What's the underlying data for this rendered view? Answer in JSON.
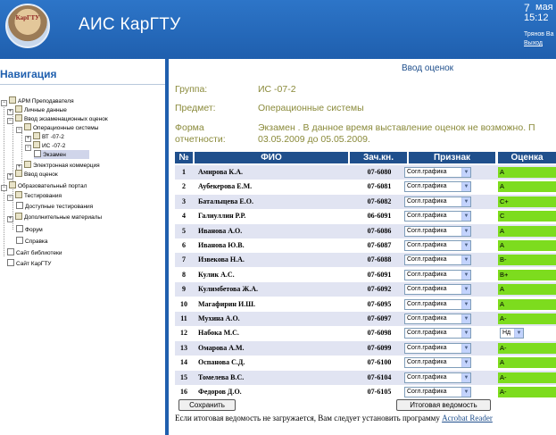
{
  "header": {
    "logo_text": "КарГТУ",
    "app_title": "АИС КарГТУ",
    "date_day": "7",
    "date_month": "мая",
    "time": "15:12",
    "user": "Трянов Ва",
    "logout": "Выход"
  },
  "sidebar": {
    "title": "Навигация",
    "items": [
      "АРМ Преподавателя",
      "Личные данные",
      "Ввод экзаменационных оценок",
      "Операционные системы",
      "ВТ -07-2",
      "ИС -07-2",
      "Экзамен",
      "Электронная коммерция",
      "Ввод оценок",
      "Образовательный портал",
      "Тестирования",
      "Доступные тестирования",
      "Дополнительные материалы",
      "Форум",
      "Справка",
      "Сайт библиотеки",
      "Сайт КарГТУ"
    ]
  },
  "main": {
    "page_title": "Ввод оценок",
    "group_label": "Группа:",
    "group_value": "ИС -07-2",
    "subject_label": "Предмет:",
    "subject_value": "Операционные системы",
    "form_label_1": "Форма",
    "form_label_2": "отчетности:",
    "form_value_1": "Экзамен . В данное время выставление оценок не возможно. П",
    "form_value_2": "03.05.2009 до 05.05.2009."
  },
  "table": {
    "headers": [
      "№",
      "ФИО",
      "Зач.кн.",
      "Признак",
      "Оценка"
    ],
    "rows": [
      {
        "num": "1",
        "fio": "Амирова К.А.",
        "zach": "07-6080",
        "priznak": "Согл.графика",
        "grade": "A"
      },
      {
        "num": "2",
        "fio": "Аубекерова Е.М.",
        "zach": "07-6081",
        "priznak": "Согл.графика",
        "grade": "A"
      },
      {
        "num": "3",
        "fio": "Баталыцева Е.О.",
        "zach": "07-6082",
        "priznak": "Согл.графика",
        "grade": "C+"
      },
      {
        "num": "4",
        "fio": "Галиуллин Р.Р.",
        "zach": "06-6091",
        "priznak": "Согл.графика",
        "grade": "C"
      },
      {
        "num": "5",
        "fio": "Иванова А.О.",
        "zach": "07-6086",
        "priznak": "Согл.графика",
        "grade": "A"
      },
      {
        "num": "6",
        "fio": "Иванова Ю.В.",
        "zach": "07-6087",
        "priznak": "Согл.графика",
        "grade": "A"
      },
      {
        "num": "7",
        "fio": "Извекова Н.А.",
        "zach": "07-6088",
        "priznak": "Согл.графика",
        "grade": "B-"
      },
      {
        "num": "8",
        "fio": "Кулик А.С.",
        "zach": "07-6091",
        "priznak": "Согл.графика",
        "grade": "B+"
      },
      {
        "num": "9",
        "fio": "Кулимбетова Ж.А.",
        "zach": "07-6092",
        "priznak": "Согл.графика",
        "grade": "A"
      },
      {
        "num": "10",
        "fio": "Магафирин И.Ш.",
        "zach": "07-6095",
        "priznak": "Согл.графика",
        "grade": "A"
      },
      {
        "num": "11",
        "fio": "Мухина А.О.",
        "zach": "07-6097",
        "priznak": "Согл.графика",
        "grade": "A-"
      },
      {
        "num": "12",
        "fio": "Набока М.С.",
        "zach": "07-6098",
        "priznak": "Согл.графика",
        "grade": "Нд"
      },
      {
        "num": "13",
        "fio": "Омарова А.М.",
        "zach": "07-6099",
        "priznak": "Согл.графика",
        "grade": "A-"
      },
      {
        "num": "14",
        "fio": "Оспанова С.Д.",
        "zach": "07-6100",
        "priznak": "Согл.графика",
        "grade": "A"
      },
      {
        "num": "15",
        "fio": "Томелева В.С.",
        "zach": "07-6104",
        "priznak": "Согл.графика",
        "grade": "A-"
      },
      {
        "num": "16",
        "fio": "Федоров Д.О.",
        "zach": "07-6105",
        "priznak": "Согл.графика",
        "grade": "A-"
      }
    ]
  },
  "actions": {
    "save": "Сохранить",
    "final": "Итоговая ведомость"
  },
  "footnote": {
    "text": "Если итоговая ведомость не загружается, Вам следует установить программу ",
    "link": "Acrobat Reader"
  }
}
